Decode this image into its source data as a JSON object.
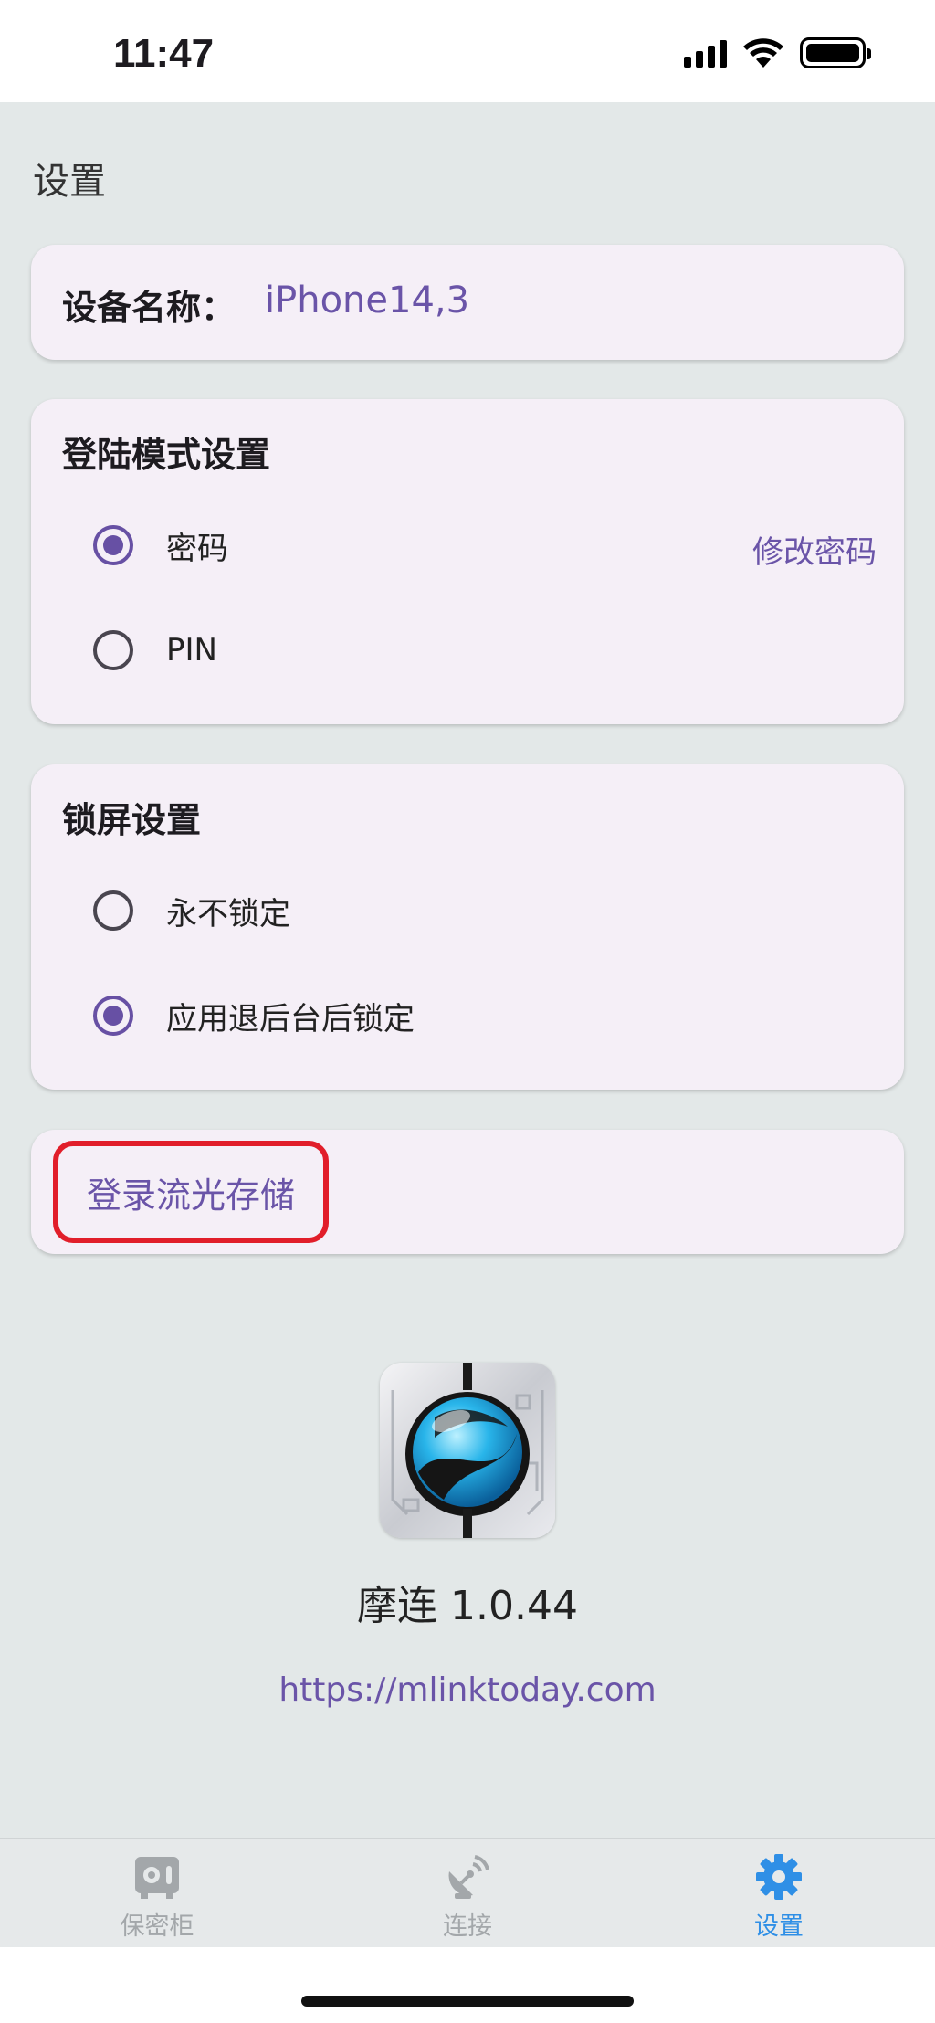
{
  "status": {
    "time": "11:47"
  },
  "page": {
    "title": "设置"
  },
  "device": {
    "label": "设备名称：",
    "value": "iPhone14,3"
  },
  "login_mode": {
    "title": "登陆模式设置",
    "options": [
      {
        "label": "密码",
        "selected": true
      },
      {
        "label": "PIN",
        "selected": false
      }
    ],
    "change_password": "修改密码"
  },
  "lock_screen": {
    "title": "锁屏设置",
    "options": [
      {
        "label": "永不锁定",
        "selected": false
      },
      {
        "label": "应用退后台后锁定",
        "selected": true
      }
    ]
  },
  "storage": {
    "login_label": "登录流光存储"
  },
  "app": {
    "version": "摩连 1.0.44",
    "url": "https://mlinktoday.com"
  },
  "tabs": [
    {
      "label": "保密柜",
      "icon": "safe-icon",
      "active": false
    },
    {
      "label": "连接",
      "icon": "satellite-dish-icon",
      "active": false
    },
    {
      "label": "设置",
      "icon": "gear-icon",
      "active": true
    }
  ],
  "colors": {
    "accent": "#6750a4",
    "link": "#6a54a8",
    "tab_active": "#2f8fe6",
    "highlight_border": "#e11e2a"
  }
}
